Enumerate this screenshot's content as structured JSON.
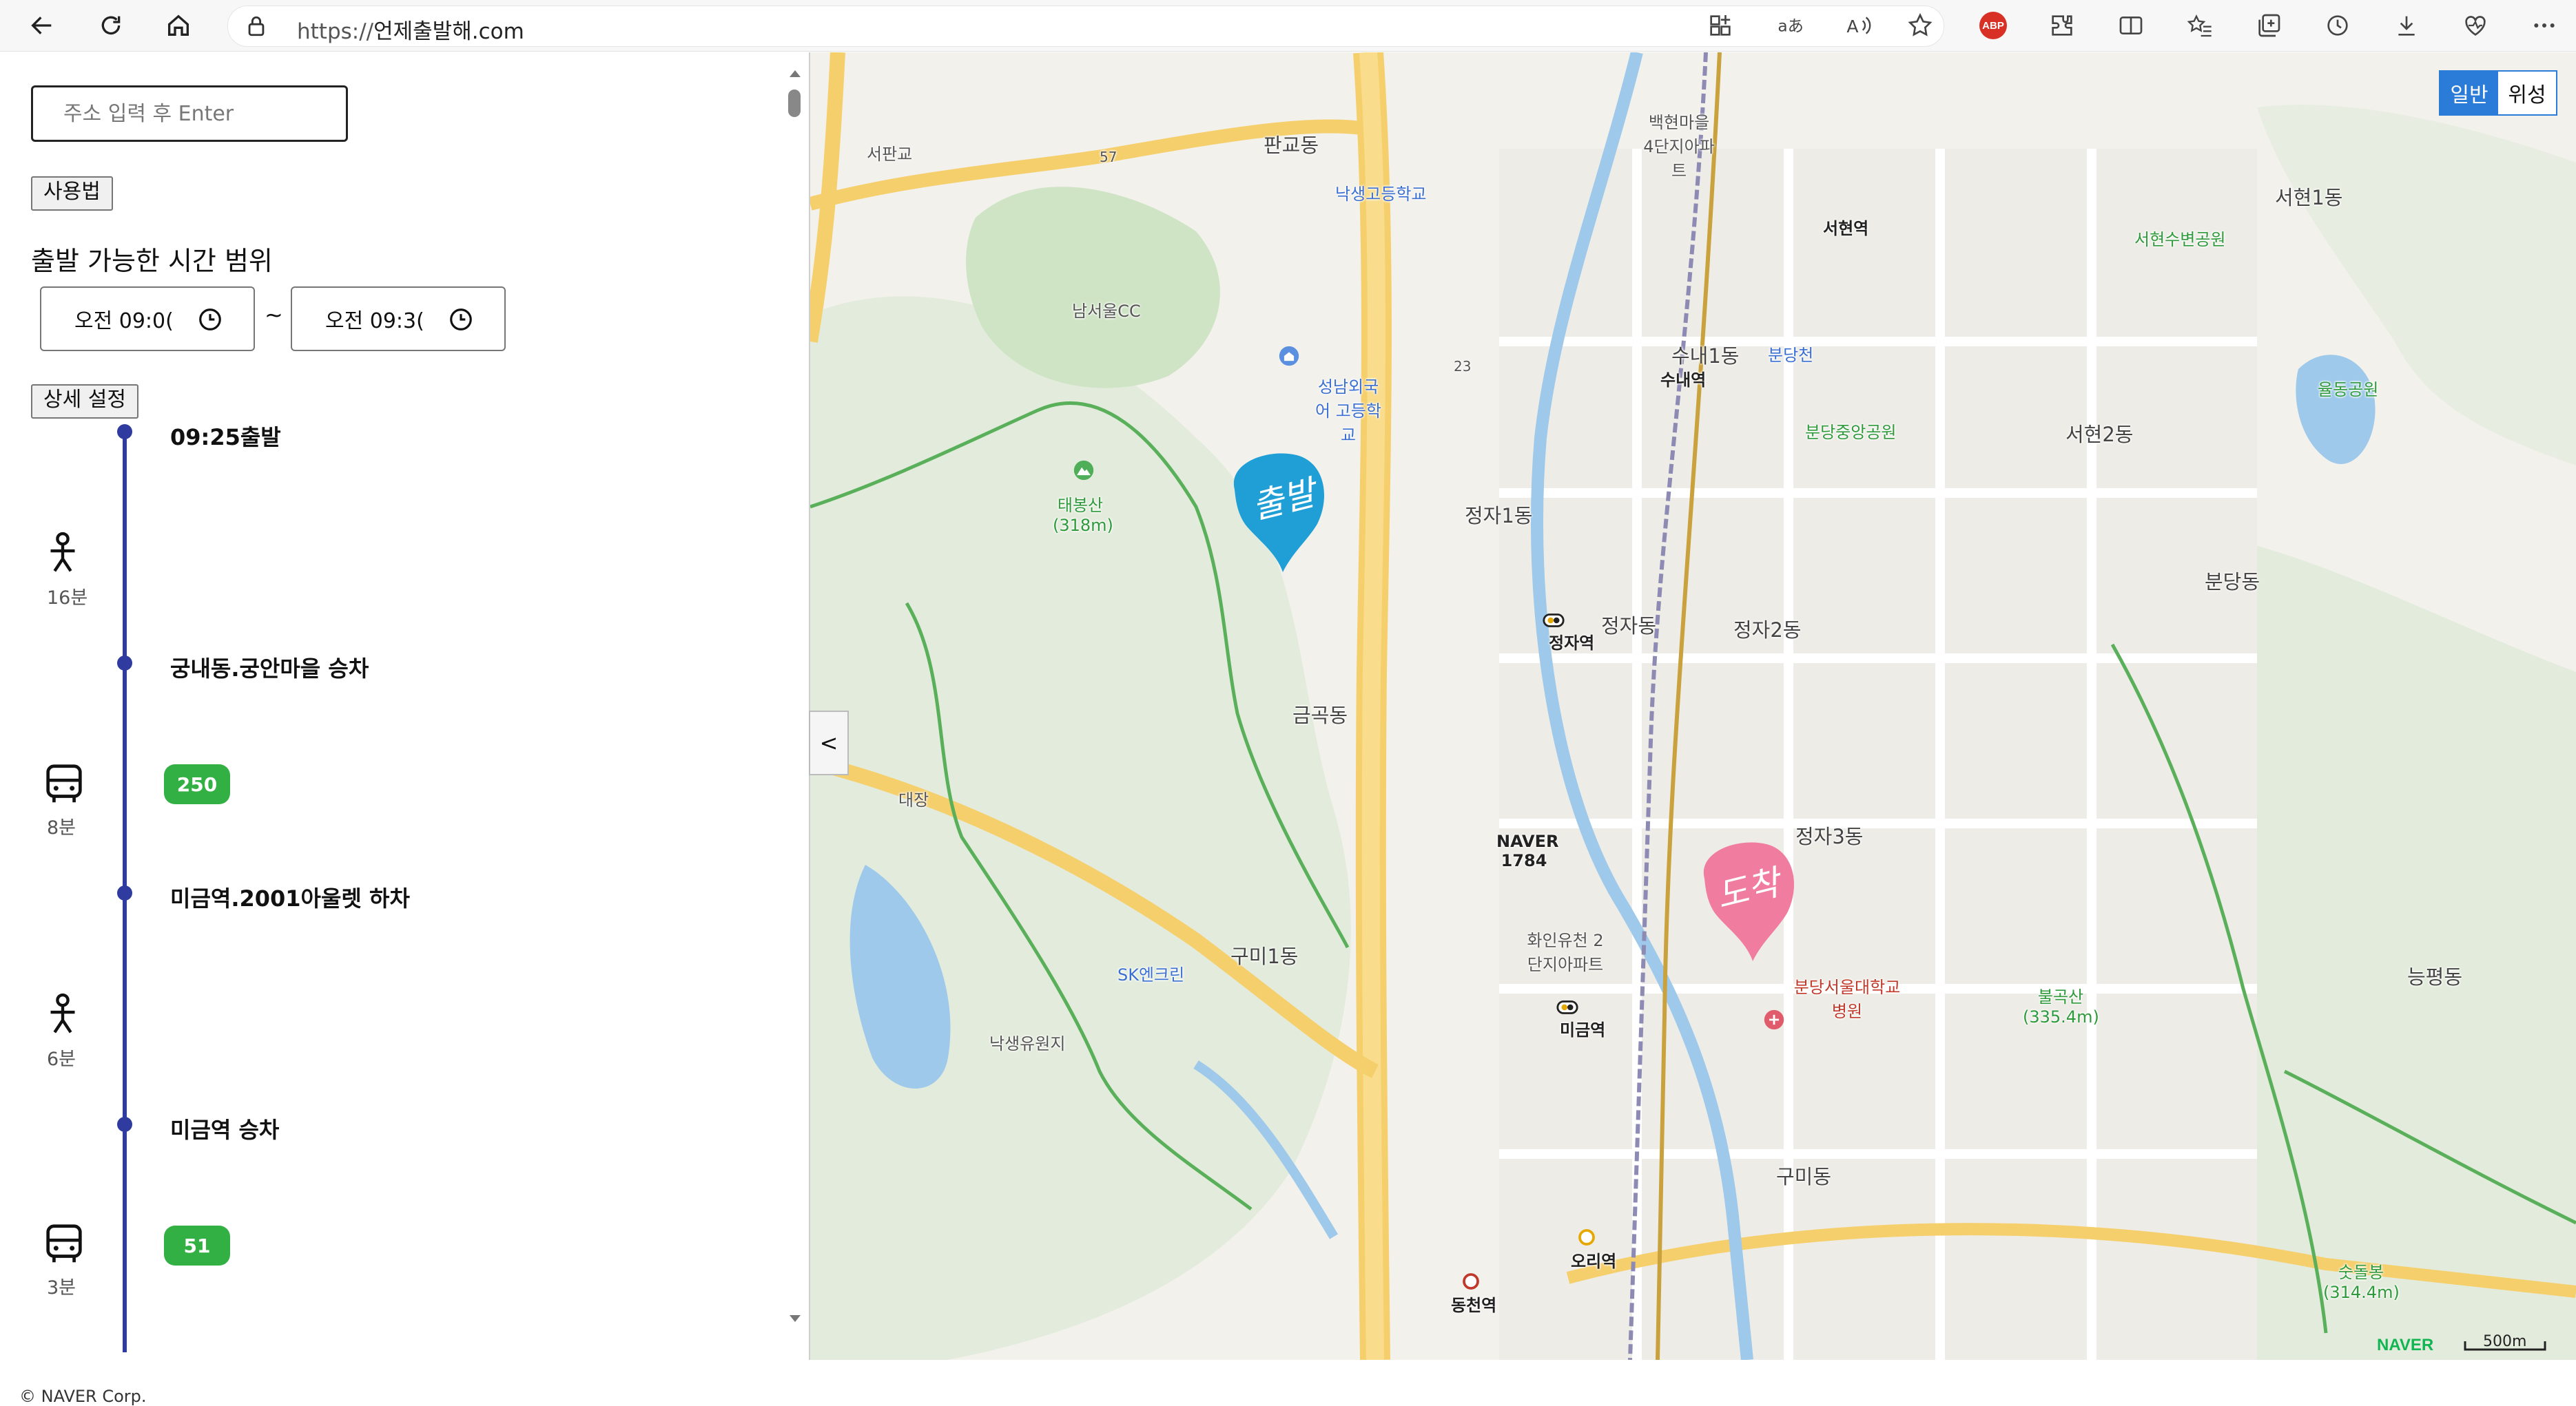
{
  "browser": {
    "url_protocol": "https://",
    "url_domain": "언제출발해.com"
  },
  "panel": {
    "address_placeholder": "주소 입력 후 Enter",
    "usage_button": "사용법",
    "departure_range_title": "출발 가능한 시간 범위",
    "time_start": "오전  09:0(",
    "time_separator": "~",
    "time_end": "오전  09:3(",
    "detail_button": "상세 설정",
    "route": [
      {
        "kind": "stop",
        "text": "09:25출발"
      },
      {
        "kind": "walk",
        "minutes": "16분"
      },
      {
        "kind": "stop",
        "text": "궁내동.궁안마을 승차"
      },
      {
        "kind": "bus",
        "number": "250",
        "minutes": "8분"
      },
      {
        "kind": "stop",
        "text": "미금역.2001아울렛 하차"
      },
      {
        "kind": "walk",
        "minutes": "6분"
      },
      {
        "kind": "stop",
        "text": "미금역 승차"
      },
      {
        "kind": "bus",
        "number": "51",
        "minutes": "3분"
      }
    ],
    "copyright": "© NAVER Corp."
  },
  "map": {
    "toggle": {
      "normal": "일반",
      "satellite": "위성"
    },
    "collapse_label": "<",
    "start_marker": "출발",
    "end_marker": "도착",
    "naver_logo": "NAVER",
    "scale_label": "500m",
    "labels": {
      "pangyo_dong": "판교동",
      "seohyeon_station": "서현역",
      "seohyeon1": "서현1동",
      "seohyeon2": "서현2동",
      "sunae1": "수내1동",
      "sunae_station": "수내역",
      "bundang_cheon": "분당천",
      "jeongja_dong": "정자동",
      "jeongja1": "정자1동",
      "jeongja2": "정자2동",
      "jeongja3": "정자3동",
      "jeongja_station": "정자역",
      "geumgok": "금곡동",
      "gumi1": "구미1동",
      "gumi": "구미동",
      "migeum_station": "미금역",
      "ori_station": "오리역",
      "dongcheon_station": "동천역",
      "bundang_dong": "분당동",
      "neungpyeong": "능평동",
      "naver_1784": "NAVER 1784",
      "taebongsan": "태봉산 (318m)",
      "bulgoksan": "불곡산 (335.4m)",
      "sutdolbong": "숫돌봉 (314.4m)",
      "hospital": "분당서울대학교 병원",
      "seongnam_school": "성남외국어 고등학교",
      "seohyeon_park": "서현수변공원",
      "yuldong_park": "율동공원",
      "bundang_central_park": "분당중앙공원",
      "hwain_apt": "화인유천 2단지아파트",
      "baekhyun": "백현마을 4단지아파트",
      "nakseong_high": "낙생고등학교",
      "sk_encline": "SK엔크린",
      "nakseong_reservoir": "낙생유원지",
      "pangyo_cc": "남서울CC",
      "daejang_ic": "대장",
      "seopangyo_ic": "서판교",
      "route_23": "23",
      "route_57": "57"
    }
  }
}
